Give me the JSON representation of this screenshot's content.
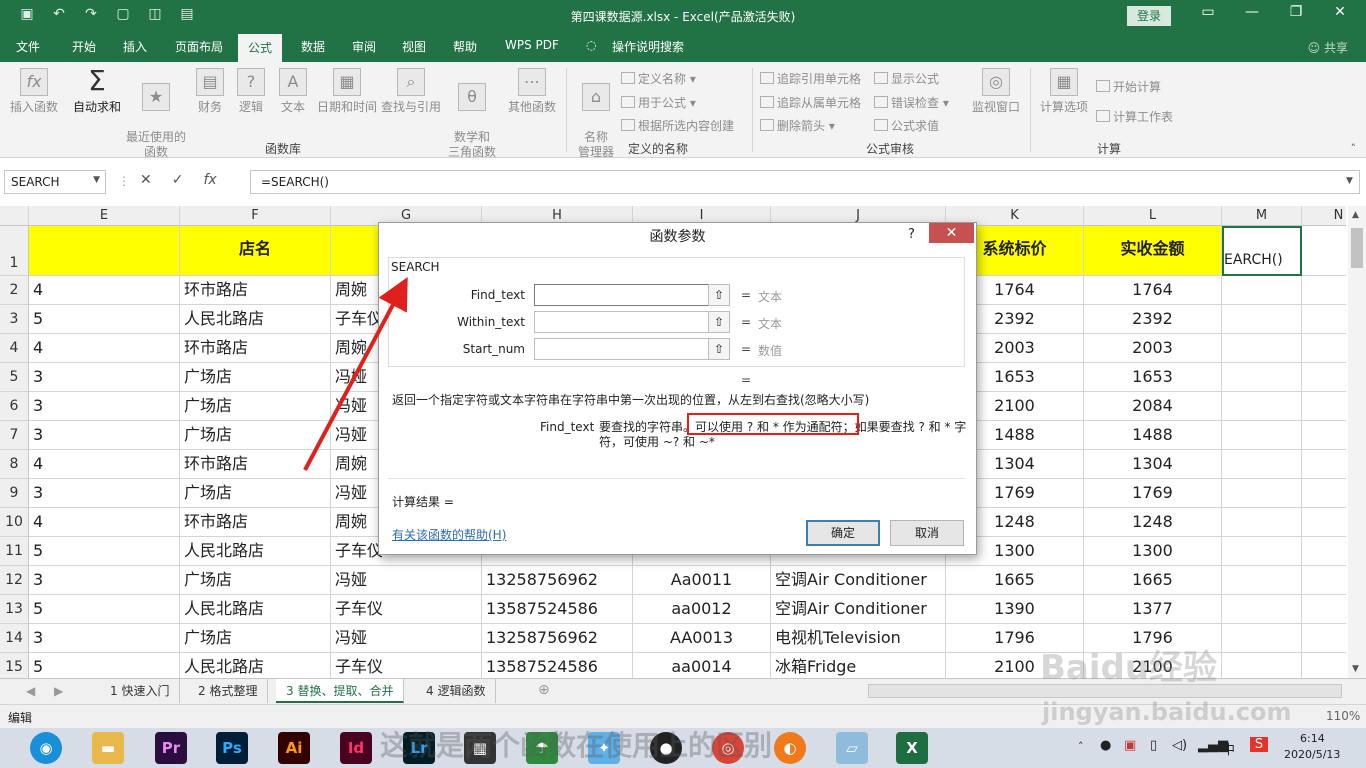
{
  "window": {
    "title": "第四课数据源.xlsx  -  Excel(产品激活失败)",
    "login_label": "登录",
    "qat_icons": [
      "save-icon",
      "undo-icon",
      "redo-icon",
      "new-icon",
      "preview-icon",
      "form-icon"
    ]
  },
  "tabs": [
    {
      "label": "文件"
    },
    {
      "label": "开始"
    },
    {
      "label": "插入"
    },
    {
      "label": "页面布局"
    },
    {
      "label": "公式",
      "active": true
    },
    {
      "label": "数据"
    },
    {
      "label": "审阅"
    },
    {
      "label": "视图"
    },
    {
      "label": "帮助"
    },
    {
      "label": "WPS PDF"
    },
    {
      "label": "操作说明搜索"
    }
  ],
  "share_label": "共享",
  "ribbon": {
    "function_library": {
      "group_label": "函数库",
      "insert_function": "插入函数",
      "autosum": "自动求和",
      "recent": "最近使用的\n函数",
      "financial": "财务",
      "logical": "逻辑",
      "text": "文本",
      "datetime": "日期和时间",
      "lookup": "查找与引用",
      "math": "数学和\n三角函数",
      "other": "其他函数"
    },
    "defined_names": {
      "group_label": "定义的名称",
      "name_manager": "名称\n管理器",
      "define_name": "定义名称",
      "use_in_formula": "用于公式",
      "create_from_selection": "根据所选内容创建"
    },
    "formula_auditing": {
      "group_label": "公式审核",
      "trace_precedents": "追踪引用单元格",
      "trace_dependents": "追踪从属单元格",
      "remove_arrows": "删除箭头",
      "show_formulas": "显示公式",
      "error_checking": "错误检查",
      "evaluate": "公式求值",
      "watch_window": "监视窗口"
    },
    "calculation": {
      "group_label": "计算",
      "calc_options": "计算选项",
      "calc_now": "开始计算",
      "calc_sheet": "计算工作表"
    }
  },
  "formula_bar": {
    "name_box": "SEARCH",
    "formula": "=SEARCH()",
    "fx": "fx"
  },
  "grid": {
    "columns": [
      "E",
      "F",
      "G",
      "H",
      "I",
      "J",
      "K",
      "L",
      "M",
      "N"
    ],
    "header_row": {
      "F": "店名",
      "K": "系统标价",
      "L": "实收金额",
      "M": "EARCH()"
    },
    "rows": [
      {
        "n": "1"
      },
      {
        "n": "2",
        "E": "4",
        "F": "环市路店",
        "G": "周婉",
        "K": "1764",
        "L": "1764"
      },
      {
        "n": "3",
        "E": "5",
        "F": "人民北路店",
        "G": "子车仪",
        "K": "2392",
        "L": "2392"
      },
      {
        "n": "4",
        "E": "4",
        "F": "环市路店",
        "G": "周婉",
        "K": "2003",
        "L": "2003"
      },
      {
        "n": "5",
        "E": "3",
        "F": "广场店",
        "G": "冯娅",
        "K": "1653",
        "L": "1653"
      },
      {
        "n": "6",
        "E": "3",
        "F": "广场店",
        "G": "冯娅",
        "K": "2100",
        "L": "2084"
      },
      {
        "n": "7",
        "E": "3",
        "F": "广场店",
        "G": "冯娅",
        "K": "1488",
        "L": "1488"
      },
      {
        "n": "8",
        "E": "4",
        "F": "环市路店",
        "G": "周婉",
        "K": "1304",
        "L": "1304"
      },
      {
        "n": "9",
        "E": "3",
        "F": "广场店",
        "G": "冯娅",
        "K": "1769",
        "L": "1769"
      },
      {
        "n": "10",
        "E": "4",
        "F": "环市路店",
        "G": "周婉",
        "K": "1248",
        "L": "1248"
      },
      {
        "n": "11",
        "E": "5",
        "F": "人民北路店",
        "G": "子车仪",
        "K": "1300",
        "L": "1300"
      },
      {
        "n": "12",
        "E": "3",
        "F": "广场店",
        "G": "冯娅",
        "H": "13258756962",
        "I": "Aa0011",
        "J": "空调Air Conditioner",
        "K": "1665",
        "L": "1665"
      },
      {
        "n": "13",
        "E": "5",
        "F": "人民北路店",
        "G": "子车仪",
        "H": "13587524586",
        "I": "aa0012",
        "J": "空调Air Conditioner",
        "K": "1390",
        "L": "1377"
      },
      {
        "n": "14",
        "E": "3",
        "F": "广场店",
        "G": "冯娅",
        "H": "13258756962",
        "I": "AA0013",
        "J": "电视机Television",
        "K": "1796",
        "L": "1796"
      },
      {
        "n": "15",
        "E": "5",
        "F": "人民北路店",
        "G": "子车仪",
        "H": "13587524586",
        "I": "aa0014",
        "J": "冰箱Fridge",
        "K": "2100",
        "L": "2100"
      }
    ]
  },
  "sheets": [
    {
      "label": "1 快速入门"
    },
    {
      "label": "2 格式整理"
    },
    {
      "label": "3 替换、提取、合并",
      "active": true
    },
    {
      "label": "4 逻辑函数"
    }
  ],
  "status": {
    "mode": "编辑",
    "zoom": "110%"
  },
  "dialog": {
    "title": "函数参数",
    "help_glyph": "?",
    "function_name": "SEARCH",
    "args": [
      {
        "label": "Find_text",
        "value": "",
        "result": "文本"
      },
      {
        "label": "Within_text",
        "value": "",
        "result": "文本"
      },
      {
        "label": "Start_num",
        "value": "",
        "result": "数值"
      }
    ],
    "eq": "=",
    "overall_eq": "=",
    "description": "返回一个指定字符或文本字符串在字符串中第一次出现的位置，从左到右查找(忽略大小写)",
    "param_name": "Find_text",
    "param_desc": "要查找的字符串。可以使用 ? 和 * 作为通配符；如果要查找 ? 和 * 字符，可使用 ~? 和 ~*",
    "result_label": "计算结果 =",
    "help_link": "有关该函数的帮助(H)",
    "ok": "确定",
    "cancel": "取消"
  },
  "taskbar": {
    "apps": [
      "Pr",
      "Ps",
      "Ai",
      "Id",
      "Lr"
    ],
    "tray_ime": "中",
    "tray_s": "S",
    "time": "6:14",
    "date": "2020/5/13"
  },
  "watermark": {
    "line1": "Baidu经验",
    "line2": "jingyan.baidu.com",
    "caption": "这就是两个函数在使用上的区别"
  },
  "colors": {
    "excel_green": "#217346",
    "header_yellow": "#ffff00",
    "annotation_red": "#e0201c"
  }
}
